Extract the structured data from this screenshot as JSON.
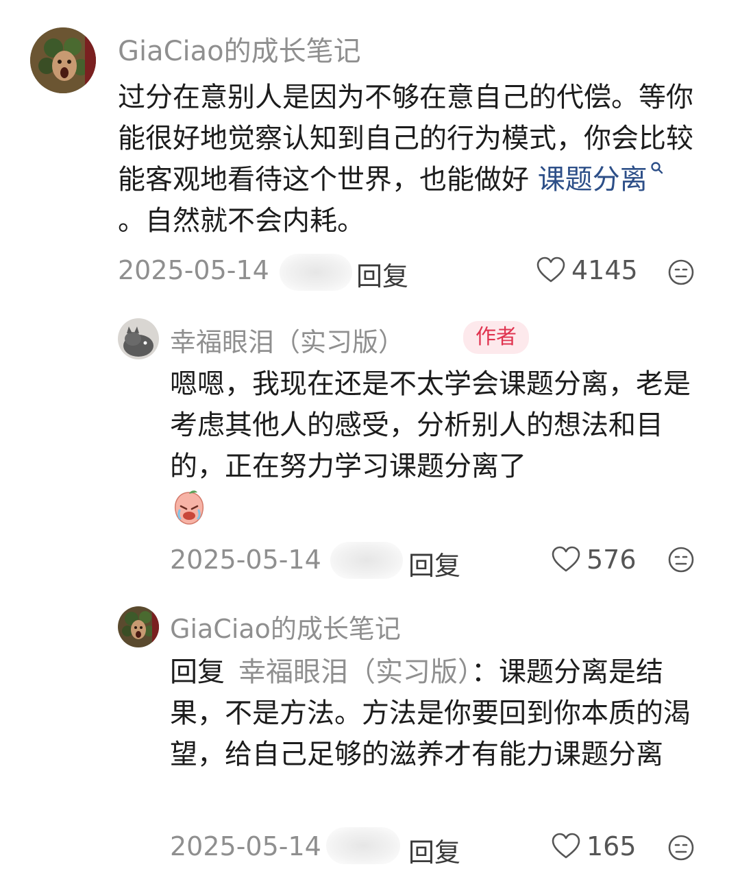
{
  "comments": [
    {
      "username": "GiaCiao的成长笔记",
      "text_before_link": "过分在意别人是因为不够在意自己的代偿。等你能很好地觉察认知到自己的行为模式，你会比较能客观地看待这个世界，也能做好 ",
      "link_text": "课题分离",
      "link_icon": "search-icon",
      "text_after_link": " 。自然就不会内耗。",
      "date": "2025-05-14",
      "reply_label": "回复",
      "likes": "4145"
    },
    {
      "username": "幸福眼泪（实习版）",
      "badge": "作者",
      "text": "嗯嗯，我现在还是不太学会课题分离，老是考虑其他人的感受，分析别人的想法和目的，正在努力学习课题分离了",
      "emoji": "crying-peach-emoji",
      "date": "2025-05-14",
      "reply_label": "回复",
      "likes": "576"
    },
    {
      "username": "GiaCiao的成长笔记",
      "reply_prefix": "回复",
      "reply_target": "幸福眼泪（实习版）",
      "reply_colon": "：",
      "text": "课题分离是结果，不是方法。方法是你要回到你本质的渴望，给自己足够的滋养才有能力课题分离",
      "date": "2025-05-14",
      "reply_label": "回复",
      "likes": "165"
    }
  ],
  "colors": {
    "username": "#8f8f8f",
    "link": "#2d4f88",
    "badge_bg": "#fde9ec",
    "badge_text": "#e0334f"
  }
}
